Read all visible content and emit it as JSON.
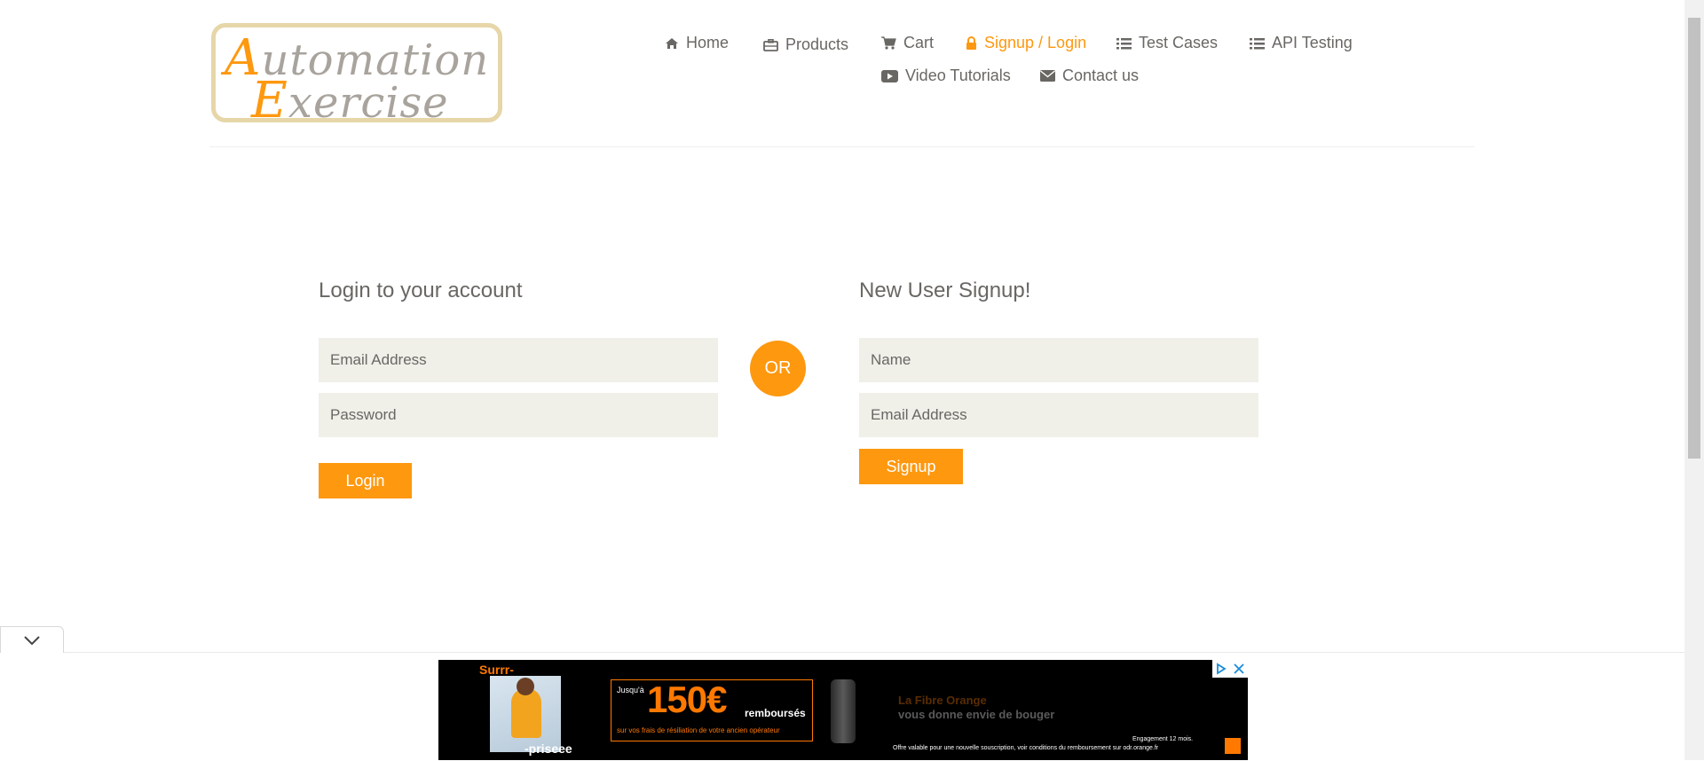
{
  "logo": {
    "alt": "Automation Exercise",
    "line1_cap": "A",
    "line1_rest": "utomation",
    "line2_cap": "E",
    "line2_rest": "xercise"
  },
  "nav": {
    "items": [
      {
        "label": "Home",
        "icon": "home-icon"
      },
      {
        "label": "Products",
        "icon": "briefcase-icon"
      },
      {
        "label": "Cart",
        "icon": "cart-icon"
      },
      {
        "label": "Signup / Login",
        "icon": "lock-icon",
        "active": true
      },
      {
        "label": "Test Cases",
        "icon": "list-icon"
      },
      {
        "label": "API Testing",
        "icon": "list-icon"
      },
      {
        "label": "Video Tutorials",
        "icon": "youtube-play-icon"
      },
      {
        "label": "Contact us",
        "icon": "envelope-icon"
      }
    ]
  },
  "login": {
    "title": "Login to your account",
    "email_placeholder": "Email Address",
    "password_placeholder": "Password",
    "button": "Login"
  },
  "or_label": "OR",
  "signup": {
    "title": "New User Signup!",
    "name_placeholder": "Name",
    "email_placeholder": "Email Address",
    "button": "Signup"
  },
  "ad": {
    "surprise_top": "Surrr-",
    "surprise_bottom": "-priseee",
    "jusqu": "Jusqu'à",
    "amount": "150€",
    "rembourses": "remboursés",
    "subline": "sur vos frais de résiliation  de votre ancien opérateur",
    "fibre": "La Fibre Orange",
    "bouger": "vous donne envie de bouger",
    "engagement": "Engagement 12 mois.",
    "fineprint": "Offre valable pour une nouvelle souscription, voir conditions du remboursement sur odr.orange.fr"
  },
  "colors": {
    "accent": "#fe980f",
    "text": "#696763",
    "field_bg": "#f0f0e9"
  }
}
